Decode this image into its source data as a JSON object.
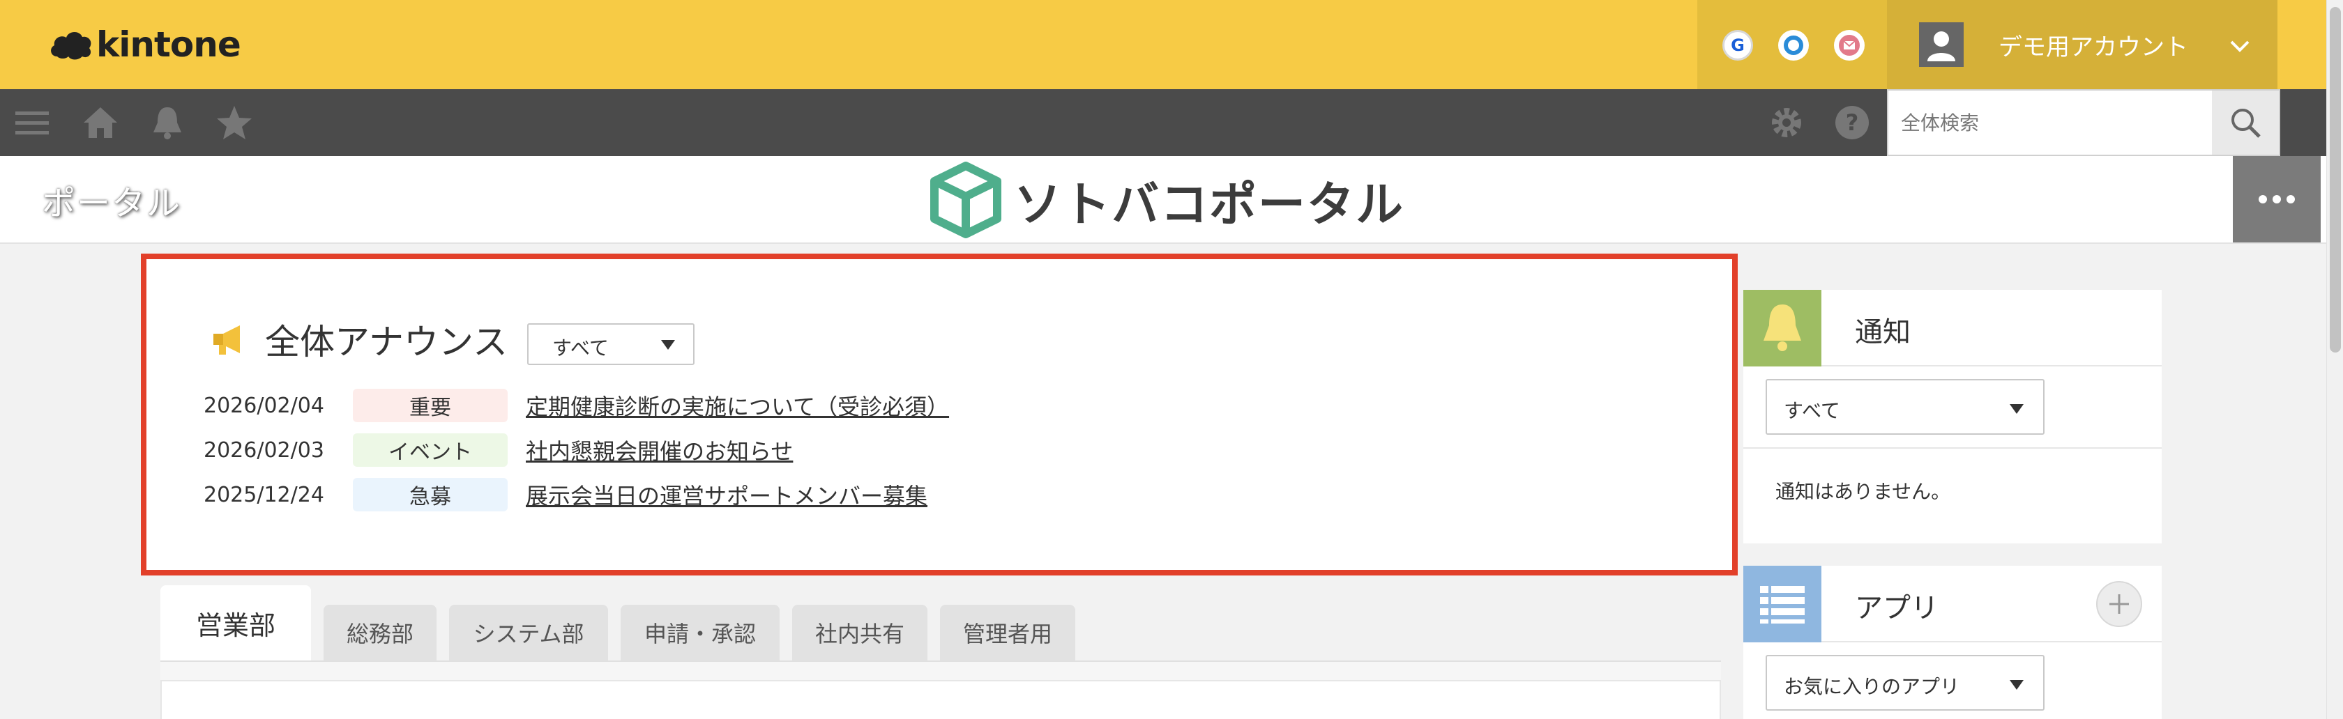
{
  "app": {
    "brand": "kintone",
    "colors": {
      "topbar": "#f7cb45",
      "toolbar": "#4b4b4b",
      "highlight": "#e2402a",
      "logo_green": "#4fae8c"
    }
  },
  "header": {
    "external_services": [
      {
        "icon": "google-icon",
        "glyph": "G"
      },
      {
        "icon": "outlook-icon",
        "glyph": "O"
      },
      {
        "icon": "mail-icon",
        "glyph": "✉"
      }
    ],
    "user": {
      "name": "デモ用アカウント",
      "avatar_icon": "user-avatar-icon"
    }
  },
  "toolbar": {
    "left_icons": [
      "menu-icon",
      "home-icon",
      "bell-icon",
      "star-icon"
    ],
    "right_icons": [
      "gear-icon",
      "help-icon"
    ],
    "search": {
      "placeholder": "全体検索",
      "value": ""
    }
  },
  "portal": {
    "title": "ポータル",
    "logo_text": "ソトバコポータル"
  },
  "announcement": {
    "title": "全体アナウンス",
    "filter": {
      "selected": "すべて"
    },
    "items": [
      {
        "date": "2026/02/04",
        "tag": "重要",
        "tag_color": "#fdecea",
        "text": "定期健康診断の実施について（受診必須）"
      },
      {
        "date": "2026/02/03",
        "tag": "イベント",
        "tag_color": "#edf8e6",
        "text": "社内懇親会開催のお知らせ"
      },
      {
        "date": "2025/12/24",
        "tag": "急募",
        "tag_color": "#eaf4fd",
        "text": "展示会当日の運営サポートメンバー募集"
      }
    ]
  },
  "tabs": [
    {
      "label": "営業部",
      "active": true
    },
    {
      "label": "総務部",
      "active": false
    },
    {
      "label": "システム部",
      "active": false
    },
    {
      "label": "申請・承認",
      "active": false
    },
    {
      "label": "社内共有",
      "active": false
    },
    {
      "label": "管理者用",
      "active": false
    }
  ],
  "widgets": {
    "notifications": {
      "title": "通知",
      "icon_color": "#9ebd63",
      "filter": "すべて",
      "empty_text": "通知はありません。"
    },
    "apps": {
      "title": "アプリ",
      "icon_color": "#8fb7e0",
      "filter": "お気に入りのアプリ"
    }
  }
}
